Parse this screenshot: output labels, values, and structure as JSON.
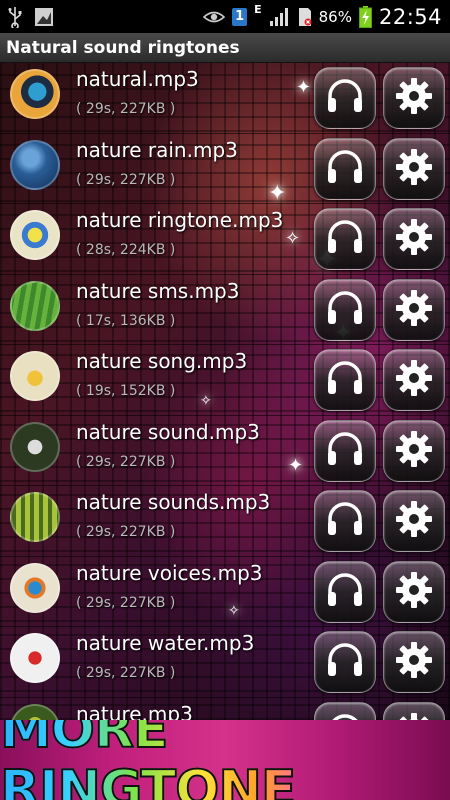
{
  "status_bar": {
    "icons": [
      "usb-icon",
      "picture-icon",
      "eye-icon",
      "sim-1-icon",
      "signal-icon",
      "sim-card-icon",
      "battery-charging-icon"
    ],
    "sim_label": "1",
    "network_type": "E",
    "battery": "86%",
    "time": "22:54"
  },
  "app": {
    "title": "Natural sound ringtones"
  },
  "ringtones": [
    {
      "name": "natural.mp3",
      "meta": "( 29s, 227KB )"
    },
    {
      "name": "nature rain.mp3",
      "meta": "( 29s, 227KB )"
    },
    {
      "name": "nature ringtone.mp3",
      "meta": "( 28s, 224KB )"
    },
    {
      "name": "nature sms.mp3",
      "meta": "( 17s, 136KB )"
    },
    {
      "name": "nature song.mp3",
      "meta": "( 19s, 152KB )"
    },
    {
      "name": "nature sound.mp3",
      "meta": "( 29s, 227KB )"
    },
    {
      "name": "nature sounds.mp3",
      "meta": "( 29s, 227KB )"
    },
    {
      "name": "nature voices.mp3",
      "meta": "( 29s, 227KB )"
    },
    {
      "name": "nature water.mp3",
      "meta": "( 29s, 227KB )"
    },
    {
      "name": "nature.mp3",
      "meta": ""
    }
  ],
  "banner": {
    "text": "MORE RINGTONE"
  }
}
